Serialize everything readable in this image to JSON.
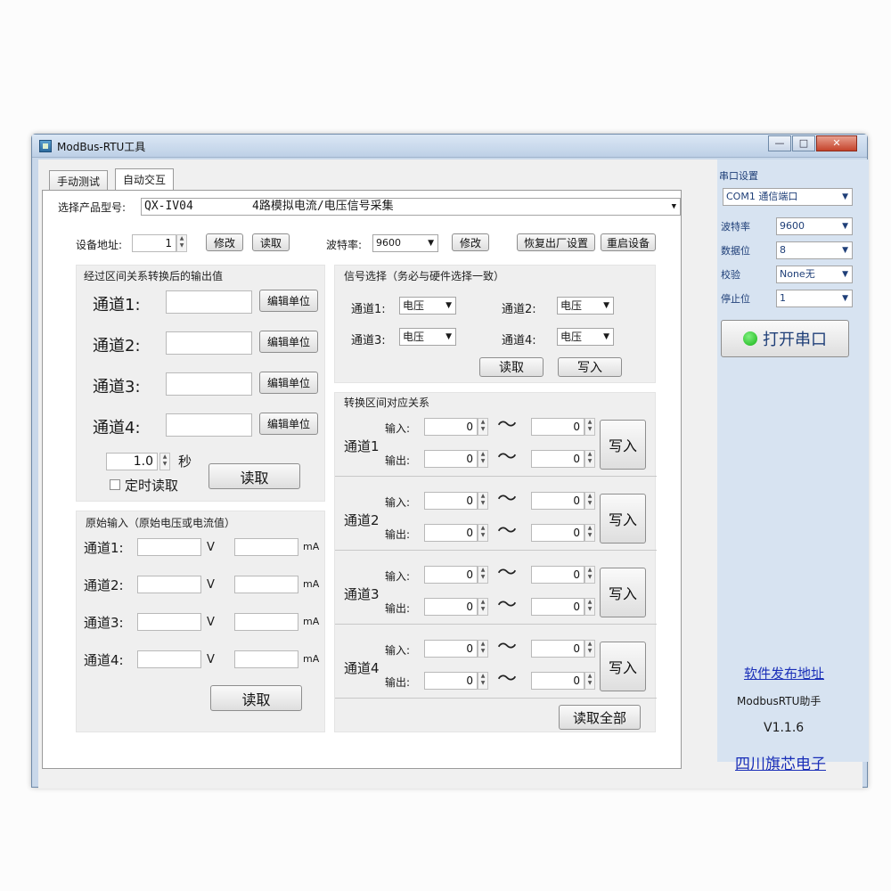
{
  "window": {
    "title": "ModBus-RTU工具",
    "min_glyph": "—",
    "max_glyph": "□",
    "close_glyph": "✕"
  },
  "tabs": [
    {
      "label": "手动测试"
    },
    {
      "label": "自动交互"
    }
  ],
  "product": {
    "label": "选择产品型号:",
    "model": "QX-IV04",
    "description": "4路模拟电流/电压信号采集"
  },
  "device": {
    "address_label": "设备地址:",
    "address_value": "1",
    "modify": "修改",
    "read": "读取",
    "baud_label": "波特率:",
    "baud_value": "9600",
    "baud_modify": "修改",
    "factory_reset": "恢复出厂设置",
    "restart": "重启设备"
  },
  "converted": {
    "title": "经过区间关系转换后的输出值",
    "channels": [
      {
        "label": "通道1:",
        "value": "",
        "unit_button": "编辑单位"
      },
      {
        "label": "通道2:",
        "value": "",
        "unit_button": "编辑单位"
      },
      {
        "label": "通道3:",
        "value": "",
        "unit_button": "编辑单位"
      },
      {
        "label": "通道4:",
        "value": "",
        "unit_button": "编辑单位"
      }
    ],
    "interval_value": "1.0",
    "interval_unit": "秒",
    "timer_read_label": "定时读取",
    "read_button": "读取"
  },
  "signal": {
    "title": "信号选择（务必与硬件选择一致）",
    "channels": [
      {
        "label": "通道1:",
        "value": "电压"
      },
      {
        "label": "通道2:",
        "value": "电压"
      },
      {
        "label": "通道3:",
        "value": "电压"
      },
      {
        "label": "通道4:",
        "value": "电压"
      }
    ],
    "read_button": "读取",
    "write_button": "写入"
  },
  "raw": {
    "title": "原始输入（原始电压或电流值）",
    "channels": [
      {
        "label": "通道1:",
        "v_unit": "V",
        "ma_unit": "mA"
      },
      {
        "label": "通道2:",
        "v_unit": "V",
        "ma_unit": "mA"
      },
      {
        "label": "通道3:",
        "v_unit": "V",
        "ma_unit": "mA"
      },
      {
        "label": "通道4:",
        "v_unit": "V",
        "ma_unit": "mA"
      }
    ],
    "read_button": "读取"
  },
  "mapping": {
    "title": "转换区间对应关系",
    "input_label": "输入:",
    "output_label": "输出:",
    "tilde": "〜",
    "channels": [
      {
        "label": "通道1",
        "in_from": "0",
        "in_to": "0",
        "out_from": "0",
        "out_to": "0",
        "write": "写入"
      },
      {
        "label": "通道2",
        "in_from": "0",
        "in_to": "0",
        "out_from": "0",
        "out_to": "0",
        "write": "写入"
      },
      {
        "label": "通道3",
        "in_from": "0",
        "in_to": "0",
        "out_from": "0",
        "out_to": "0",
        "write": "写入"
      },
      {
        "label": "通道4",
        "in_from": "0",
        "in_to": "0",
        "out_from": "0",
        "out_to": "0",
        "write": "写入"
      }
    ],
    "read_all": "读取全部"
  },
  "serial": {
    "title": "串口设置",
    "port": "COM1 通信端口",
    "baud_label": "波特率",
    "baud_value": "9600",
    "databits_label": "数据位",
    "databits_value": "8",
    "parity_label": "校验",
    "parity_value": "None无",
    "stopbits_label": "停止位",
    "stopbits_value": "1",
    "open_button": "打开串口",
    "status_color": "#16b316"
  },
  "footer": {
    "release_link": "软件发布地址",
    "app_name": "ModbusRTU助手",
    "version": "V1.1.6",
    "company_link": "四川旗芯电子"
  }
}
